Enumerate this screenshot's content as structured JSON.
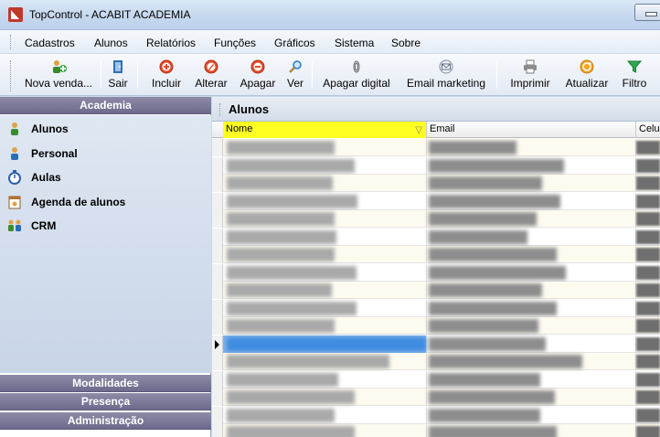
{
  "window": {
    "title": "TopControl - ACABIT ACADEMIA"
  },
  "menu": [
    "Cadastros",
    "Alunos",
    "Relatórios",
    "Funções",
    "Gráficos",
    "Sistema",
    "Sobre"
  ],
  "toolbar": [
    {
      "label": "Nova venda...",
      "icon": "people-add-icon"
    },
    {
      "label": "Sair",
      "icon": "exit-door-icon"
    },
    {
      "label": "Incluir",
      "icon": "plus-circle-icon"
    },
    {
      "label": "Alterar",
      "icon": "edit-circle-icon"
    },
    {
      "label": "Apagar",
      "icon": "minus-circle-icon"
    },
    {
      "label": "Ver",
      "icon": "magnifier-icon"
    },
    {
      "label": "Apagar digital",
      "icon": "fingerprint-icon"
    },
    {
      "label": "Email marketing",
      "icon": "envelope-icon"
    },
    {
      "label": "Imprimir",
      "icon": "printer-icon"
    },
    {
      "label": "Atualizar",
      "icon": "refresh-icon"
    },
    {
      "label": "Filtro",
      "icon": "funnel-icon"
    }
  ],
  "nav": {
    "header": "Academia",
    "items": [
      {
        "label": "Alunos",
        "icon": "student-icon"
      },
      {
        "label": "Personal",
        "icon": "trainer-icon"
      },
      {
        "label": "Aulas",
        "icon": "stopwatch-icon"
      },
      {
        "label": "Agenda de alunos",
        "icon": "calendar-icon"
      },
      {
        "label": "CRM",
        "icon": "group-icon"
      }
    ],
    "sections": [
      "Modalidades",
      "Presença",
      "Administração"
    ]
  },
  "grid": {
    "title": "Alunos",
    "columns": [
      "Nome",
      "Email",
      "Celul"
    ],
    "selected_row_index": 11
  },
  "colors": {
    "filter_header": "#ffff22",
    "selection": "#7fb2ea",
    "nav_header": "#7a779a"
  }
}
